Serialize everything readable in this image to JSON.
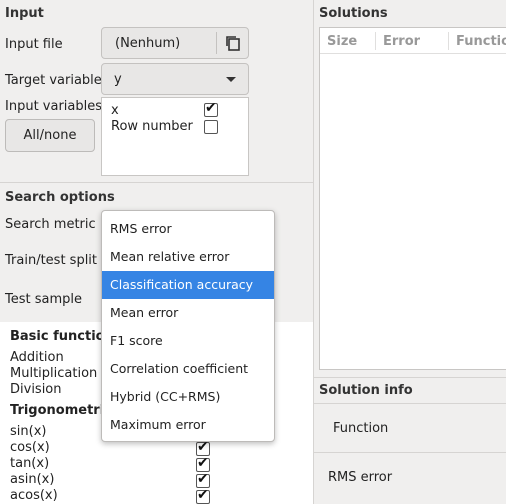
{
  "input": {
    "section_title": "Input",
    "input_file_label": "Input file",
    "input_file_value": "(Nenhum)",
    "target_variable_label": "Target variable",
    "target_variable_value": "y",
    "input_variables_label": "Input variables",
    "all_none_label": "All/none",
    "variables": [
      {
        "name": "x",
        "checked": true
      },
      {
        "name": "Row number",
        "checked": false
      }
    ]
  },
  "search": {
    "section_title": "Search options",
    "metric_label": "Search metric",
    "split_label": "Train/test split",
    "sample_label": "Test sample",
    "dropdown": {
      "options": [
        "RMS error",
        "Mean relative error",
        "Classification accuracy",
        "Mean error",
        "F1 score",
        "Correlation coefficient",
        "Hybrid (CC+RMS)",
        "Maximum error"
      ],
      "highlighted_index": 2
    }
  },
  "functions": {
    "basic_title": "Basic functions",
    "basic": [
      "Addition",
      "Multiplication",
      "Division"
    ],
    "trig_title": "Trigonometric",
    "trig": [
      {
        "name": "sin(x)",
        "checked": true
      },
      {
        "name": "cos(x)",
        "checked": true
      },
      {
        "name": "tan(x)",
        "checked": true
      },
      {
        "name": "asin(x)",
        "checked": true
      },
      {
        "name": "acos(x)",
        "checked": true
      }
    ]
  },
  "solutions": {
    "section_title": "Solutions",
    "columns": [
      "Size",
      "Error",
      "Function"
    ]
  },
  "solution_info": {
    "section_title": "Solution info",
    "function_label": "Function",
    "rms_label": "RMS error"
  }
}
